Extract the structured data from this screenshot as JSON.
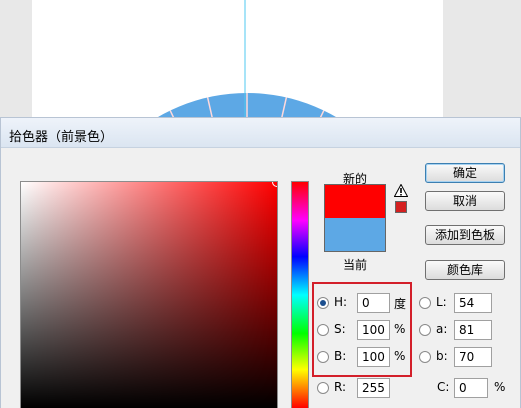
{
  "dialog": {
    "title": "拾色器（前景色）"
  },
  "swatches": {
    "new_label": "新的",
    "current_label": "当前",
    "new_color": "#ff0000",
    "current_color": "#5da8e5",
    "gamut_color": "#d42020"
  },
  "buttons": {
    "ok": "确定",
    "cancel": "取消",
    "add_to_swatches": "添加到色板",
    "color_libraries": "颜色库"
  },
  "hsb": {
    "h": {
      "label": "H:",
      "value": "0",
      "unit": "度",
      "selected": true
    },
    "s": {
      "label": "S:",
      "value": "100",
      "unit": "%"
    },
    "b": {
      "label": "B:",
      "value": "100",
      "unit": "%"
    }
  },
  "lab": {
    "l": {
      "label": "L:",
      "value": "54"
    },
    "a": {
      "label": "a:",
      "value": "81"
    },
    "b": {
      "label": "b:",
      "value": "70"
    }
  },
  "rgb": {
    "r": {
      "label": "R:",
      "value": "255"
    }
  },
  "cmyk": {
    "c": {
      "label": "C:",
      "value": "0",
      "unit": "%"
    }
  },
  "colors": {
    "ring": "#5da8e5",
    "accent_highlight": "#d31f2a"
  }
}
